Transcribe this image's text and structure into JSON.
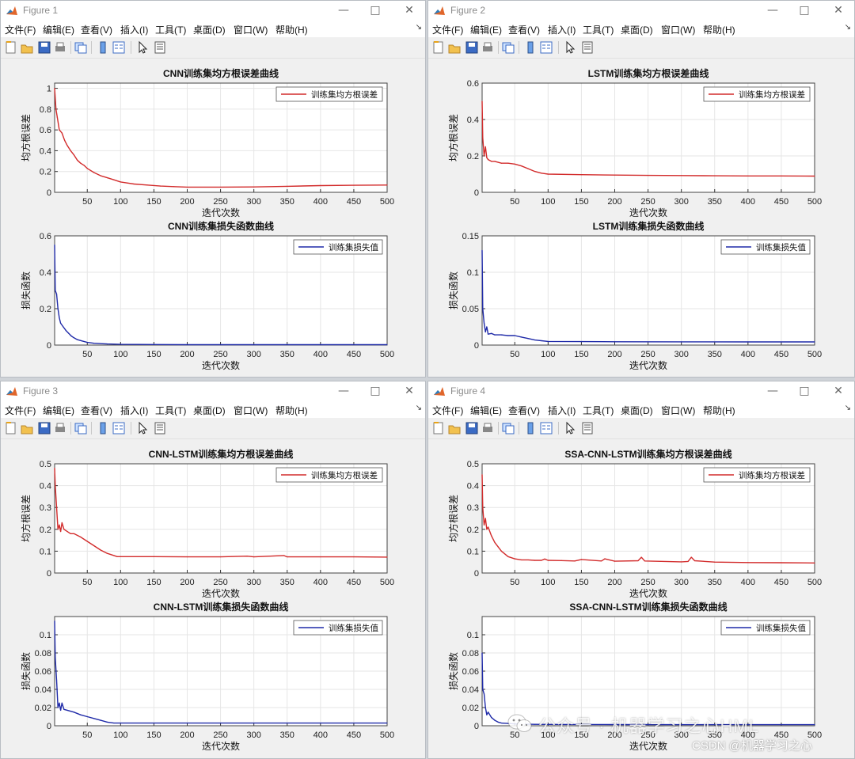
{
  "windows": [
    {
      "title": "Figure 1",
      "menus": [
        "文件(F)",
        "编辑(E)",
        "查看(V)",
        "插入(I)",
        "工具(T)",
        "桌面(D)",
        "窗口(W)",
        "帮助(H)"
      ],
      "plots": [
        {
          "title": "CNN训练集均方根误差曲线",
          "xlabel": "迭代次数",
          "ylabel": "均方根误差",
          "legend": "训练集均方根误差",
          "color": "#d22b2b",
          "xticks": [
            "50",
            "100",
            "150",
            "200",
            "250",
            "300",
            "350",
            "400",
            "450",
            "500"
          ],
          "yticks": [
            "0",
            "0.2",
            "0.4",
            "0.6",
            "0.8",
            "1"
          ]
        },
        {
          "title": "CNN训练集损失函数曲线",
          "xlabel": "迭代次数",
          "ylabel": "损失函数",
          "legend": "训练集损失值",
          "color": "#1f2aa8",
          "xticks": [
            "50",
            "100",
            "150",
            "200",
            "250",
            "300",
            "350",
            "400",
            "450",
            "500"
          ],
          "yticks": [
            "0",
            "0.2",
            "0.4",
            "0.6"
          ]
        }
      ]
    },
    {
      "title": "Figure 2",
      "menus": [
        "文件(F)",
        "编辑(E)",
        "查看(V)",
        "插入(I)",
        "工具(T)",
        "桌面(D)",
        "窗口(W)",
        "帮助(H)"
      ],
      "plots": [
        {
          "title": "LSTM训练集均方根误差曲线",
          "xlabel": "迭代次数",
          "ylabel": "均方根误差",
          "legend": "训练集均方根误差",
          "color": "#d22b2b",
          "xticks": [
            "50",
            "100",
            "150",
            "200",
            "250",
            "300",
            "350",
            "400",
            "450",
            "500"
          ],
          "yticks": [
            "0",
            "0.2",
            "0.4",
            "0.6"
          ]
        },
        {
          "title": "LSTM训练集损失函数曲线",
          "xlabel": "迭代次数",
          "ylabel": "损失函数",
          "legend": "训练集损失值",
          "color": "#1f2aa8",
          "xticks": [
            "50",
            "100",
            "150",
            "200",
            "250",
            "300",
            "350",
            "400",
            "450",
            "500"
          ],
          "yticks": [
            "0",
            "0.05",
            "0.1",
            "0.15"
          ]
        }
      ]
    },
    {
      "title": "Figure 3",
      "menus": [
        "文件(F)",
        "编辑(E)",
        "查看(V)",
        "插入(I)",
        "工具(T)",
        "桌面(D)",
        "窗口(W)",
        "帮助(H)"
      ],
      "plots": [
        {
          "title": "CNN-LSTM训练集均方根误差曲线",
          "xlabel": "迭代次数",
          "ylabel": "均方根误差",
          "legend": "训练集均方根误差",
          "color": "#d22b2b",
          "xticks": [
            "50",
            "100",
            "150",
            "200",
            "250",
            "300",
            "350",
            "400",
            "450",
            "500"
          ],
          "yticks": [
            "0",
            "0.1",
            "0.2",
            "0.3",
            "0.4",
            "0.5"
          ]
        },
        {
          "title": "CNN-LSTM训练集损失函数曲线",
          "xlabel": "迭代次数",
          "ylabel": "损失函数",
          "legend": "训练集损失值",
          "color": "#1f2aa8",
          "xticks": [
            "50",
            "100",
            "150",
            "200",
            "250",
            "300",
            "350",
            "400",
            "450",
            "500"
          ],
          "yticks": [
            "0",
            "0.02",
            "0.04",
            "0.06",
            "0.08",
            "0.1"
          ]
        }
      ]
    },
    {
      "title": "Figure 4",
      "menus": [
        "文件(F)",
        "编辑(E)",
        "查看(V)",
        "插入(I)",
        "工具(T)",
        "桌面(D)",
        "窗口(W)",
        "帮助(H)"
      ],
      "plots": [
        {
          "title": "SSA-CNN-LSTM训练集均方根误差曲线",
          "xlabel": "迭代次数",
          "ylabel": "均方根误差",
          "legend": "训练集均方根误差",
          "color": "#d22b2b",
          "xticks": [
            "50",
            "100",
            "150",
            "200",
            "250",
            "300",
            "350",
            "400",
            "450",
            "500"
          ],
          "yticks": [
            "0",
            "0.1",
            "0.2",
            "0.3",
            "0.4",
            "0.5"
          ]
        },
        {
          "title": "SSA-CNN-LSTM训练集损失函数曲线",
          "xlabel": "迭代次数",
          "ylabel": "损失函数",
          "legend": "训练集损失值",
          "color": "#1f2aa8",
          "xticks": [
            "50",
            "100",
            "150",
            "200",
            "250",
            "300",
            "350",
            "400",
            "450",
            "500"
          ],
          "yticks": [
            "0",
            "0.02",
            "0.04",
            "0.06",
            "0.08",
            "0.1"
          ]
        }
      ]
    }
  ],
  "chart_data": [
    {
      "type": "line",
      "title": "CNN训练集均方根误差曲线",
      "xlabel": "迭代次数",
      "ylabel": "均方根误差",
      "xlim": [
        1,
        500
      ],
      "ylim": [
        0,
        1.05
      ],
      "grid": true,
      "legend_position": "top-right",
      "series": [
        {
          "name": "训练集均方根误差",
          "x": [
            1,
            3,
            5,
            8,
            12,
            16,
            20,
            25,
            30,
            35,
            40,
            45,
            50,
            60,
            70,
            80,
            90,
            100,
            110,
            120,
            140,
            160,
            180,
            200,
            250,
            300,
            350,
            400,
            450,
            500
          ],
          "y": [
            1.0,
            0.8,
            0.72,
            0.6,
            0.57,
            0.5,
            0.45,
            0.4,
            0.36,
            0.31,
            0.28,
            0.26,
            0.23,
            0.19,
            0.16,
            0.14,
            0.12,
            0.1,
            0.09,
            0.08,
            0.07,
            0.06,
            0.055,
            0.05,
            0.05,
            0.052,
            0.058,
            0.065,
            0.068,
            0.07
          ]
        }
      ]
    },
    {
      "type": "line",
      "title": "CNN训练集损失函数曲线",
      "xlabel": "迭代次数",
      "ylabel": "损失函数",
      "xlim": [
        1,
        500
      ],
      "ylim": [
        0,
        0.6
      ],
      "grid": true,
      "legend_position": "top-right",
      "series": [
        {
          "name": "训练集损失值",
          "x": [
            1,
            2,
            4,
            6,
            8,
            10,
            14,
            18,
            22,
            26,
            30,
            35,
            40,
            50,
            60,
            80,
            100,
            150,
            200,
            300,
            400,
            500
          ],
          "y": [
            0.55,
            0.3,
            0.28,
            0.2,
            0.15,
            0.12,
            0.1,
            0.08,
            0.065,
            0.05,
            0.04,
            0.03,
            0.025,
            0.015,
            0.01,
            0.006,
            0.004,
            0.003,
            0.002,
            0.002,
            0.002,
            0.002
          ]
        }
      ]
    },
    {
      "type": "line",
      "title": "LSTM训练集均方根误差曲线",
      "xlabel": "迭代次数",
      "ylabel": "均方根误差",
      "xlim": [
        1,
        500
      ],
      "ylim": [
        0,
        0.6
      ],
      "grid": true,
      "legend_position": "top-right",
      "series": [
        {
          "name": "训练集均方根误差",
          "x": [
            1,
            2,
            4,
            6,
            8,
            10,
            15,
            20,
            30,
            40,
            50,
            60,
            70,
            80,
            90,
            100,
            150,
            200,
            250,
            300,
            350,
            400,
            450,
            500
          ],
          "y": [
            0.5,
            0.3,
            0.2,
            0.25,
            0.19,
            0.18,
            0.17,
            0.17,
            0.16,
            0.16,
            0.155,
            0.145,
            0.13,
            0.115,
            0.105,
            0.1,
            0.097,
            0.095,
            0.093,
            0.092,
            0.091,
            0.09,
            0.09,
            0.089
          ]
        }
      ]
    },
    {
      "type": "line",
      "title": "LSTM训练集损失函数曲线",
      "xlabel": "迭代次数",
      "ylabel": "损失函数",
      "xlim": [
        1,
        500
      ],
      "ylim": [
        0,
        0.15
      ],
      "grid": true,
      "legend_position": "top-right",
      "series": [
        {
          "name": "训练集损失值",
          "x": [
            1,
            2,
            4,
            6,
            8,
            10,
            15,
            20,
            30,
            40,
            50,
            60,
            70,
            80,
            90,
            100,
            150,
            200,
            300,
            400,
            500
          ],
          "y": [
            0.13,
            0.05,
            0.03,
            0.018,
            0.025,
            0.015,
            0.016,
            0.014,
            0.014,
            0.013,
            0.013,
            0.011,
            0.009,
            0.007,
            0.006,
            0.005,
            0.0048,
            0.0046,
            0.0045,
            0.0044,
            0.0044
          ]
        }
      ]
    },
    {
      "type": "line",
      "title": "CNN-LSTM训练集均方根误差曲线",
      "xlabel": "迭代次数",
      "ylabel": "均方根误差",
      "xlim": [
        1,
        500
      ],
      "ylim": [
        0,
        0.5
      ],
      "grid": true,
      "legend_position": "top-right",
      "series": [
        {
          "name": "训练集均方根误差",
          "x": [
            1,
            2,
            4,
            6,
            8,
            10,
            12,
            15,
            20,
            25,
            30,
            40,
            50,
            60,
            70,
            80,
            90,
            95,
            100,
            150,
            200,
            250,
            290,
            300,
            345,
            350,
            400,
            450,
            500
          ],
          "y": [
            0.48,
            0.4,
            0.3,
            0.2,
            0.22,
            0.19,
            0.23,
            0.2,
            0.19,
            0.18,
            0.18,
            0.165,
            0.145,
            0.125,
            0.105,
            0.09,
            0.08,
            0.075,
            0.075,
            0.075,
            0.074,
            0.074,
            0.077,
            0.074,
            0.08,
            0.074,
            0.074,
            0.074,
            0.073
          ]
        }
      ]
    },
    {
      "type": "line",
      "title": "CNN-LSTM训练集损失函数曲线",
      "xlabel": "迭代次数",
      "ylabel": "损失函数",
      "xlim": [
        1,
        500
      ],
      "ylim": [
        0,
        0.12
      ],
      "grid": true,
      "legend_position": "top-right",
      "series": [
        {
          "name": "训练集损失值",
          "x": [
            1,
            2,
            4,
            6,
            8,
            10,
            12,
            15,
            20,
            30,
            40,
            50,
            60,
            70,
            80,
            90,
            100,
            150,
            200,
            300,
            400,
            500
          ],
          "y": [
            0.115,
            0.075,
            0.05,
            0.02,
            0.025,
            0.017,
            0.025,
            0.018,
            0.017,
            0.015,
            0.012,
            0.01,
            0.008,
            0.006,
            0.004,
            0.003,
            0.003,
            0.003,
            0.003,
            0.003,
            0.003,
            0.003
          ]
        }
      ]
    },
    {
      "type": "line",
      "title": "SSA-CNN-LSTM训练集均方根误差曲线",
      "xlabel": "迭代次数",
      "ylabel": "均方根误差",
      "xlim": [
        1,
        500
      ],
      "ylim": [
        0,
        0.5
      ],
      "grid": true,
      "legend_position": "top-right",
      "series": [
        {
          "name": "训练集均方根误差",
          "x": [
            1,
            2,
            4,
            6,
            8,
            10,
            15,
            20,
            25,
            30,
            40,
            50,
            60,
            70,
            80,
            90,
            95,
            100,
            120,
            140,
            150,
            180,
            185,
            200,
            235,
            240,
            245,
            300,
            310,
            315,
            320,
            350,
            400,
            450,
            500
          ],
          "y": [
            0.45,
            0.3,
            0.22,
            0.25,
            0.2,
            0.21,
            0.17,
            0.14,
            0.12,
            0.1,
            0.075,
            0.065,
            0.06,
            0.06,
            0.058,
            0.058,
            0.064,
            0.058,
            0.057,
            0.055,
            0.062,
            0.055,
            0.065,
            0.054,
            0.056,
            0.072,
            0.055,
            0.051,
            0.053,
            0.072,
            0.056,
            0.05,
            0.048,
            0.047,
            0.046
          ]
        }
      ]
    },
    {
      "type": "line",
      "title": "SSA-CNN-LSTM训练集损失函数曲线",
      "xlabel": "迭代次数",
      "ylabel": "损失函数",
      "xlim": [
        1,
        500
      ],
      "ylim": [
        0,
        0.12
      ],
      "grid": true,
      "legend_position": "top-right",
      "series": [
        {
          "name": "训练集损失值",
          "x": [
            1,
            2,
            4,
            6,
            8,
            10,
            15,
            20,
            25,
            30,
            40,
            50,
            60,
            80,
            100,
            150,
            200,
            300,
            400,
            500
          ],
          "y": [
            0.08,
            0.04,
            0.035,
            0.02,
            0.012,
            0.015,
            0.009,
            0.006,
            0.004,
            0.003,
            0.0025,
            0.002,
            0.0018,
            0.0016,
            0.0015,
            0.0014,
            0.0013,
            0.0012,
            0.0012,
            0.0012
          ]
        }
      ]
    }
  ],
  "watermark": {
    "text": "公众号 · 机器学习之心HML",
    "credit": "CSDN @机器学习之心"
  }
}
